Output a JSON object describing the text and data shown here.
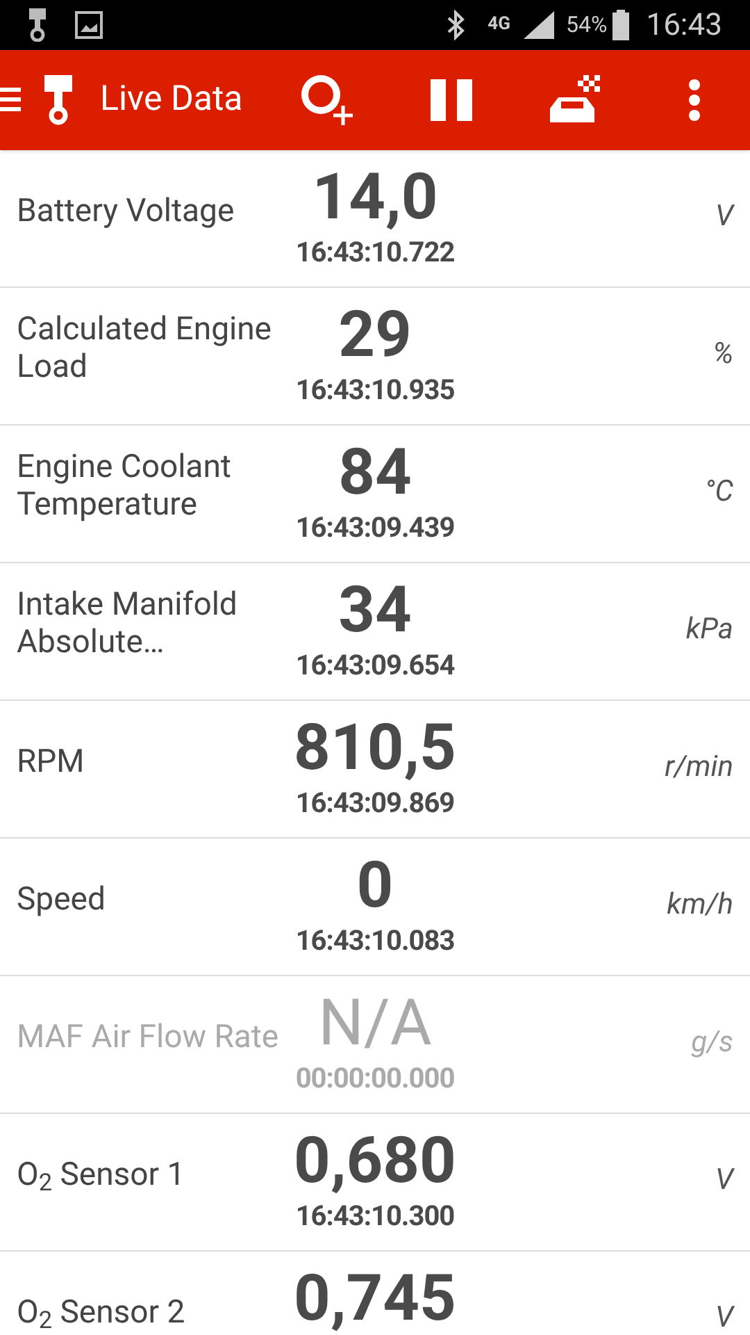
{
  "status_bar": {
    "network": "4G",
    "battery": "54%",
    "time": "16:43"
  },
  "app_bar": {
    "title": "Live Data"
  },
  "rows": [
    {
      "label": "Battery Voltage",
      "value": "14,0",
      "unit": "V",
      "timestamp": "16:43:10.722",
      "disabled": false
    },
    {
      "label": "Calculated Engine Load",
      "value": "29",
      "unit": "%",
      "timestamp": "16:43:10.935",
      "disabled": false
    },
    {
      "label": "Engine Coolant Temperature",
      "value": "84",
      "unit": "°C",
      "timestamp": "16:43:09.439",
      "disabled": false
    },
    {
      "label": "Intake Manifold Absolute…",
      "value": "34",
      "unit": "kPa",
      "timestamp": "16:43:09.654",
      "disabled": false
    },
    {
      "label": "RPM",
      "value": "810,5",
      "unit": "r/min",
      "timestamp": "16:43:09.869",
      "disabled": false
    },
    {
      "label": "Speed",
      "value": "0",
      "unit": "km/h",
      "timestamp": "16:43:10.083",
      "disabled": false
    },
    {
      "label": "MAF Air Flow Rate",
      "value": "N/A",
      "unit": "g/s",
      "timestamp": "00:00:00.000",
      "disabled": true
    },
    {
      "label": "O$_{2}$ Sensor 1",
      "value": "0,680",
      "unit": "V",
      "timestamp": "16:43:10.300",
      "disabled": false
    },
    {
      "label": "O$_{2}$ Sensor 2",
      "value": "0,745",
      "unit": "V",
      "disabled": false
    }
  ]
}
